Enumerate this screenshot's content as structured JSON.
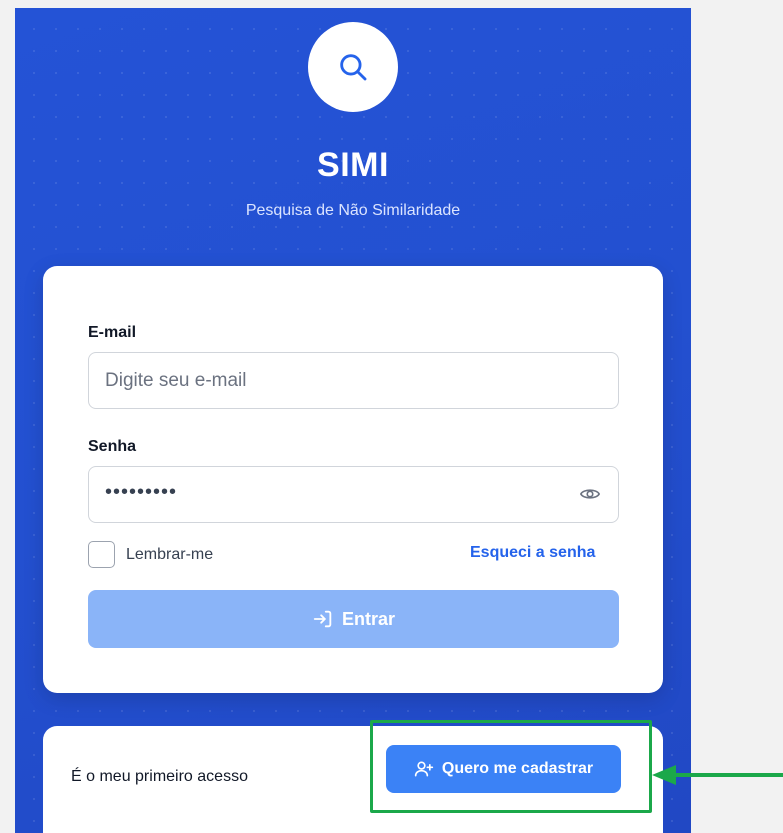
{
  "app": {
    "title": "SIMI",
    "subtitle": "Pesquisa de Não Similaridade",
    "logo_icon": "search-icon"
  },
  "login": {
    "email_label": "E-mail",
    "email_placeholder": "Digite seu e-mail",
    "email_value": "",
    "password_label": "Senha",
    "password_masked": "•••••••••",
    "password_toggle_icon": "eye-icon",
    "remember_label": "Lembrar-me",
    "remember_checked": false,
    "forgot_label": "Esqueci a senha",
    "submit_label": "Entrar",
    "submit_icon": "login-arrow-icon"
  },
  "first_access": {
    "text": "É o meu primeiro acesso",
    "register_label": "Quero me cadastrar",
    "register_icon": "user-plus-icon"
  },
  "colors": {
    "panel_blue": "#2453d6",
    "primary": "#3b82f6",
    "primary_disabled": "#8ab4f8",
    "link": "#2563eb",
    "highlight_green": "#1ba84a"
  }
}
